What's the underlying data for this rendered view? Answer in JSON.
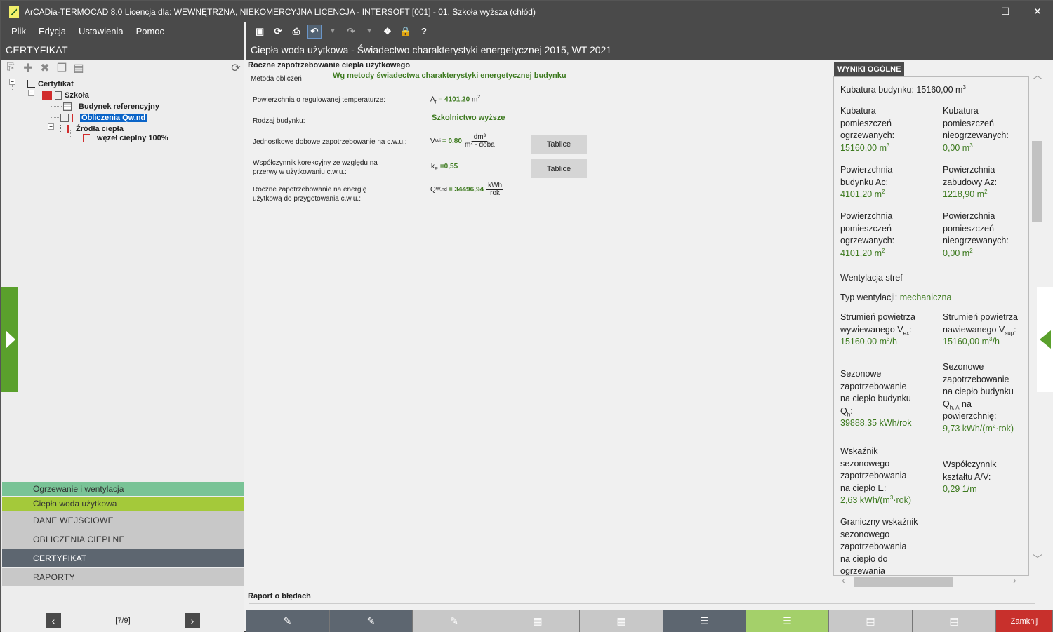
{
  "window": {
    "title": "ArCADia-TERMOCAD 8.0 Licencja dla: WEWNĘTRZNA, NIEKOMERCYJNA LICENCJA - INTERSOFT [001] - 01. Szkoła wyższa (chłód)",
    "minimize": "—",
    "maximize": "☐",
    "close": "✕"
  },
  "menu": [
    "Plik",
    "Edycja",
    "Ustawienia",
    "Pomoc"
  ],
  "left": {
    "header": "CERTYFIKAT",
    "tree": {
      "root": "Certyfikat",
      "building": "Szkoła",
      "ref_building": "Budynek referencyjny",
      "calc": "Obliczenia Qw,nd",
      "sources": "Źródła ciepła",
      "node": "węzeł cieplny 100%"
    },
    "modes": [
      "Ogrzewanie i wentylacja",
      "Ciepła woda użytkowa"
    ],
    "sections": [
      "DANE WEJŚCIOWE",
      "OBLICZENIA CIEPLNE",
      "CERTYFIKAT",
      "RAPORTY"
    ],
    "pager": "[7/9]",
    "pager_prev": "‹",
    "pager_next": "›"
  },
  "main": {
    "header": "Ciepła woda użytkowa - Świadectwo charakterystyki energetycznej 2015, WT 2021",
    "section_title": "Roczne zapotrzebowanie ciepła użytkowego",
    "method_label": "Metoda obliczeń",
    "method_value": "Wg metody świadectwa charakterystyki energetycznej budynku",
    "area_label": "Powierzchnia o regulowanej temperaturze:",
    "area_sym": "A",
    "area_sub": "f",
    "area_value": "= 4101,20",
    "area_unit": "m",
    "area_unit_sup": "2",
    "building_type_label": "Rodzaj budynku:",
    "building_type_value": "Szkolnictwo wyższe",
    "daily_label": "Jednostkowe dobowe zapotrzebowanie na c.w.u.:",
    "daily_sym": "V",
    "daily_sub": "Wi",
    "daily_value": "= 0,80",
    "daily_unit_num": "dm³",
    "daily_unit_den": "m² · doba",
    "corr_label_1": "Współczynnik korekcyjny ze względu na",
    "corr_label_2": "przerwy w użytkowaniu c.w.u.:",
    "corr_sym": "k",
    "corr_sub": "R",
    "corr_value": "=0,55",
    "annual_label_1": "Roczne zapotrzebowanie na energię",
    "annual_label_2": "użytkową do przygotowania c.w.u.:",
    "annual_sym": "Q",
    "annual_sub": "W,nd",
    "annual_value": "= 34496,94",
    "annual_unit_num": "kWh",
    "annual_unit_den": "rok",
    "tables_button": "Tablice",
    "error_report": "Raport o błędach",
    "close_button": "Zamknij"
  },
  "results": {
    "tab": "WYNIKI OGÓLNE",
    "kubatura": "Kubatura budynku: ",
    "kubatura_val": "15160,00 m",
    "ogrz_label": [
      "Kubatura",
      "pomieszczeń",
      "ogrzewanych:"
    ],
    "ogrz_val": "15160,00 m",
    "nieogrz_label": [
      "Kubatura",
      "pomieszczeń",
      "nieogrzewanych:"
    ],
    "nieogrz_val": "0,00 m",
    "ac_label": [
      "Powierzchnia",
      "budynku Ac:"
    ],
    "ac_val": "4101,20 m",
    "az_label": [
      "Powierzchnia",
      "zabudowy Az:"
    ],
    "az_val": "1218,90 m",
    "pog_label": [
      "Powierzchnia",
      "pomieszczeń",
      "ogrzewanych:"
    ],
    "pog_val": "4101,20 m",
    "pnog_label": [
      "Powierzchnia",
      "pomieszczeń",
      "nieogrzewanych:"
    ],
    "pnog_val": "0,00 m",
    "went": "Wentylacja stref",
    "went_type": "Typ wentylacji: ",
    "went_type_val": "mechaniczna",
    "ex_label": [
      "Strumień powietrza",
      "wywiewanego V"
    ],
    "ex_sub": "ex",
    "ex_val": "15160,00 m",
    "sup_label": [
      "Strumień powietrza",
      "nawiewanego V"
    ],
    "sup_sub": "sup",
    "sup_val": "15160,00 m",
    "qh_label": [
      "Sezonowe",
      "zapotrzebowanie",
      "na ciepło budynku",
      "Q"
    ],
    "qh_sub": "h",
    "qh_val": "39888,35 kWh/rok",
    "qha_label": [
      "Sezonowe",
      "zapotrzebowanie",
      "na ciepło budynku",
      "Q",
      "na",
      "powierzchnię:"
    ],
    "qha_sub": "h, A",
    "qha_val": "9,73 kWh/(m",
    "e_label": [
      "Wskaźnik",
      "sezonowego",
      "zapotrzebowania",
      "na ciepło E:"
    ],
    "e_val": "2,63 kWh/(m",
    "av_label": [
      "Współczynnik",
      "kształtu A/V:"
    ],
    "av_val": "0,29 1/m",
    "gr_label": [
      "Graniczny wskaźnik",
      "sezonowego",
      "zapotrzebowania",
      "na ciepło do",
      "ogrzewania"
    ]
  },
  "colors": {
    "accent_green": "#5aa02c",
    "value_green": "#3d7a1f",
    "selection_blue": "#0a64c8",
    "close_red": "#c8302c"
  }
}
